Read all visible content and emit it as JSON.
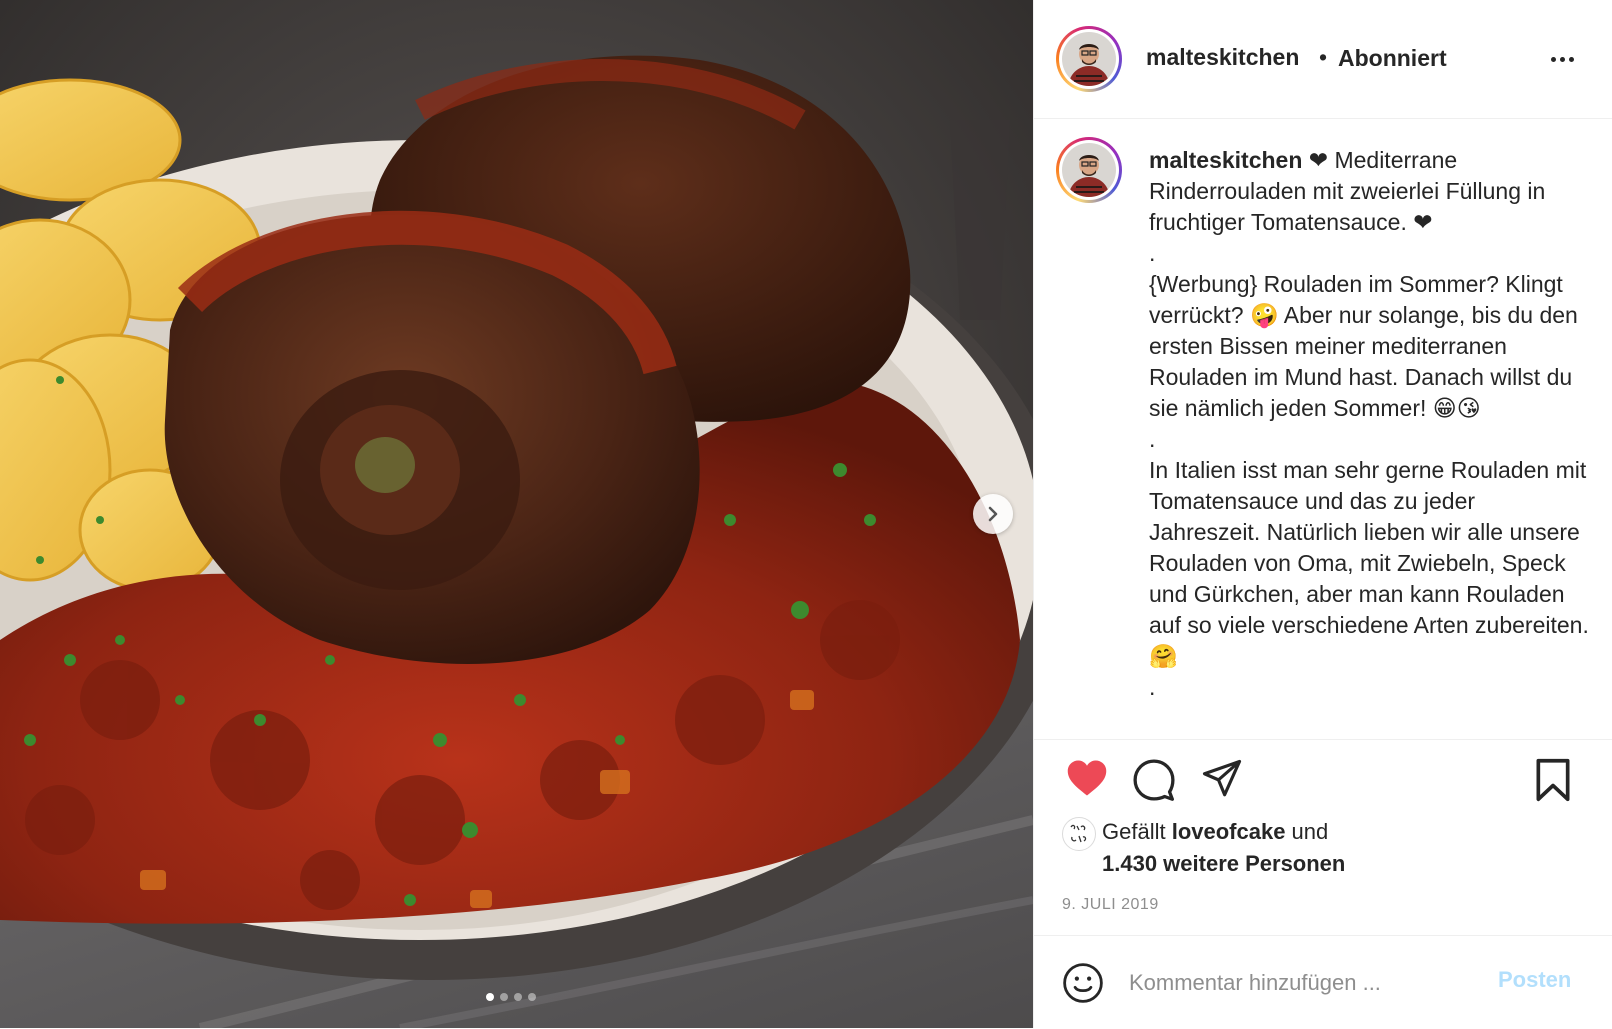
{
  "header": {
    "username": "malteskitchen",
    "separator": "•",
    "follow_status": "Abonniert",
    "more_icon": "more-horizontal-icon"
  },
  "caption": {
    "username": "malteskitchen",
    "paragraphs": [
      "❤ Mediterrane Rinderrouladen mit zweierlei Füllung in fruchtiger Tomatensauce. ❤",
      ".",
      "{Werbung} Rouladen im Sommer? Klingt verrückt? 🤪 Aber nur solange, bis du den ersten Bissen meiner mediterranen Rouladen im Mund hast. Danach willst du sie nämlich jeden Sommer! 😁😘",
      ".",
      "In Italien isst man sehr gerne Rouladen mit Tomatensauce und das zu jeder Jahreszeit. Natürlich lieben wir alle unsere Rouladen von Oma, mit Zwiebeln, Speck und Gürkchen, aber man kann Rouladen auf so viele verschiedene Arten zubereiten. 🤗",
      "."
    ]
  },
  "actions": {
    "like_icon": "heart-filled-icon",
    "comment_icon": "comment-icon",
    "share_icon": "paper-plane-icon",
    "save_icon": "bookmark-icon",
    "like_color": "#ed4956"
  },
  "likes": {
    "prefix": "Gefällt ",
    "liked_by": "loveofcake",
    "suffix": " und",
    "others": "1.430 weitere Personen"
  },
  "date": "9. JULI 2019",
  "comment": {
    "placeholder": "Kommentar hinzufügen ...",
    "post_label": "Posten",
    "emoji_icon": "smiley-icon"
  },
  "carousel": {
    "next_icon": "chevron-right-icon",
    "slide_count": 4,
    "active_index": 0
  },
  "colors": {
    "text": "#262626",
    "muted": "#8e8e8e",
    "post_button": "#b2dffc"
  }
}
